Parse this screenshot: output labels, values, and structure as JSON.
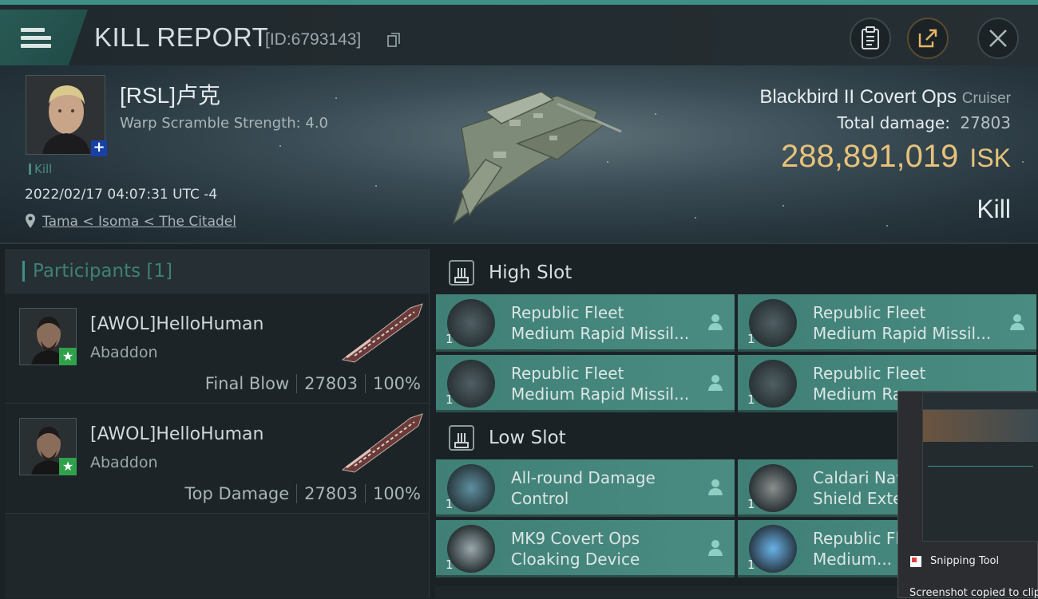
{
  "header": {
    "title": "KILL REPORT",
    "report_id": "[ID:6793143]"
  },
  "victim": {
    "name": "[RSL]卢克",
    "warp_scramble": "Warp Scramble Strength: 4.0",
    "tag": "Kill",
    "datetime": "2022/02/17 04:07:31 UTC -4",
    "location": "Tama < Isoma < The Citadel"
  },
  "ship": {
    "name": "Blackbird II Covert Ops",
    "class": "Cruiser",
    "total_damage_label": "Total damage:",
    "total_damage": "27803",
    "isk_value": "288,891,019",
    "isk_unit": "ISK",
    "result": "Kill"
  },
  "participants": {
    "header": "Participants [1]",
    "rows": [
      {
        "name": "[AWOL]HelloHuman",
        "ship": "Abaddon",
        "role": "Final Blow",
        "damage": "27803",
        "percent": "100%"
      },
      {
        "name": "[AWOL]HelloHuman",
        "ship": "Abaddon",
        "role": "Top Damage",
        "damage": "27803",
        "percent": "100%"
      }
    ]
  },
  "slots": {
    "high_label": "High Slot",
    "low_label": "Low Slot",
    "high": [
      {
        "line1": "Republic Fleet",
        "line2": "Medium Rapid Missil...",
        "qty": "1"
      },
      {
        "line1": "Republic Fleet",
        "line2": "Medium Rapid Missil...",
        "qty": "1"
      },
      {
        "line1": "Republic Fleet",
        "line2": "Medium Rapid Missil...",
        "qty": "1"
      },
      {
        "line1": "Republic Fleet",
        "line2": "Medium Ra",
        "qty": "1"
      }
    ],
    "low": [
      {
        "line1": "All-round Damage",
        "line2": "Control",
        "qty": "1"
      },
      {
        "line1": "Caldari Nav",
        "line2": "Shield Exte",
        "qty": "1"
      },
      {
        "line1": "MK9 Covert Ops",
        "line2": "Cloaking Device",
        "qty": "1"
      },
      {
        "line1": "Republic Fl",
        "line2": "Medium...",
        "qty": "1"
      }
    ]
  },
  "toast": {
    "app": "Snipping Tool",
    "message": "Screenshot copied to clip"
  },
  "colors": {
    "accent": "#3e8f86",
    "isk": "#e6c27a",
    "module_bg": "#458579"
  }
}
